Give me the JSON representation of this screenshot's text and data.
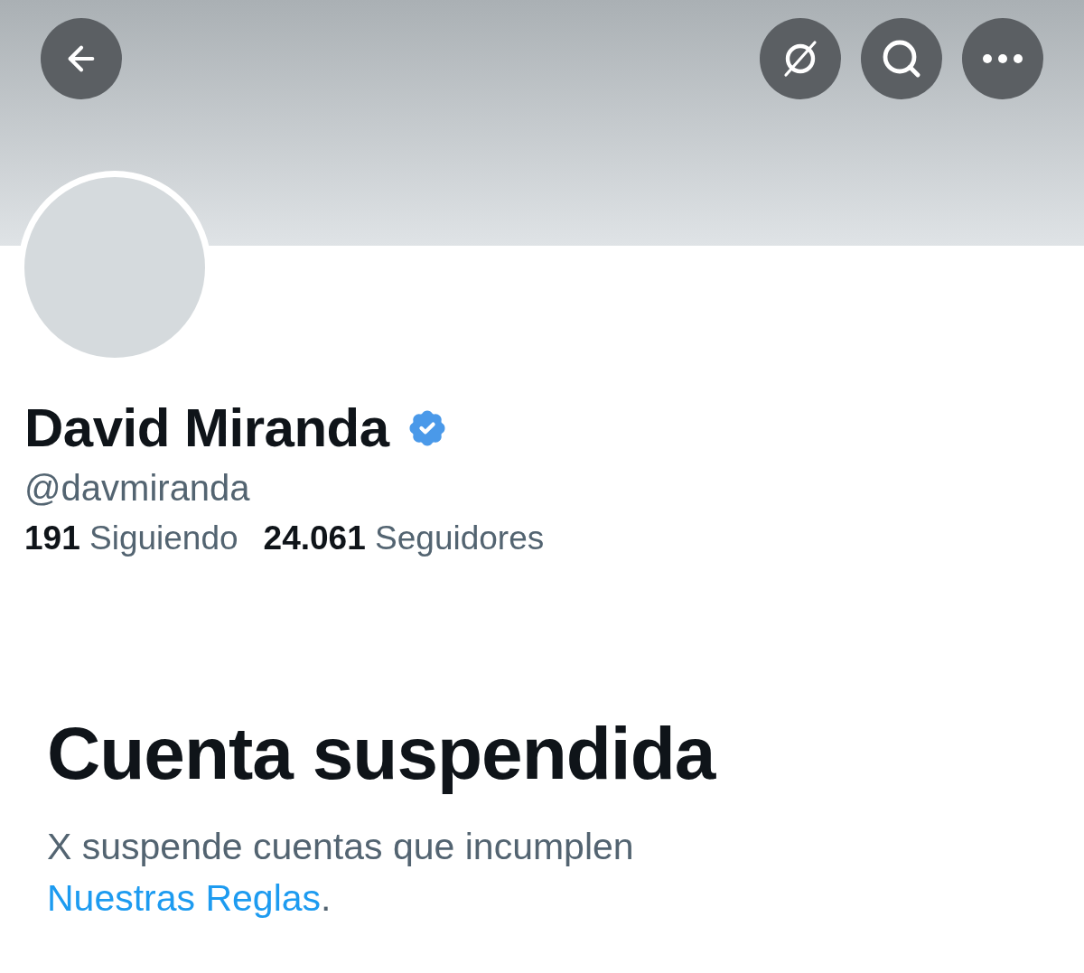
{
  "profile": {
    "name": "David Miranda",
    "verified": true,
    "handle": "@davmiranda"
  },
  "stats": [
    {
      "text": "**191** Siguiendo"
    },
    {
      "text": "**24.061** Seguidores"
    }
  ],
  "notice": {
    "title": "Cuenta suspendida",
    "body": "X suspende cuentas que incumplen",
    "link": "Nuestras Reglas",
    "end": "."
  }
}
